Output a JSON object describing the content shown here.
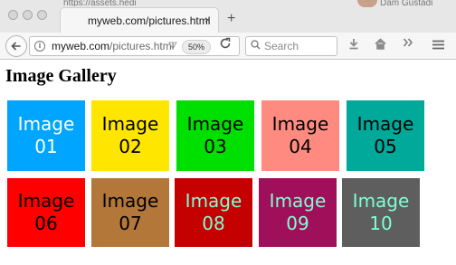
{
  "browser": {
    "ghost_tab_text": "https://assets.hedi",
    "ghost_right_text": "Dam Gustadi",
    "active_tab_title": "myweb.com/pictures.html",
    "tab_close_glyph": "×",
    "new_tab_glyph": "+",
    "url_domain": "myweb.com",
    "url_path": "/pictures.html",
    "zoom_level": "50%",
    "search_placeholder": "Search",
    "icons": [
      "back-arrow-icon",
      "info-icon",
      "reader-view-icon",
      "reload-icon",
      "search-icon",
      "download-icon",
      "home-icon",
      "overflow-chevrons-icon",
      "hamburger-menu-icon"
    ]
  },
  "page": {
    "title": "Image Gallery",
    "tiles": [
      {
        "line1": "Image",
        "line2": "01",
        "bg": "#00a5ff",
        "fg": "#ffffff"
      },
      {
        "line1": "Image",
        "line2": "02",
        "bg": "#ffe600",
        "fg": "#000000"
      },
      {
        "line1": "Image",
        "line2": "03",
        "bg": "#00e000",
        "fg": "#000000"
      },
      {
        "line1": "Image",
        "line2": "04",
        "bg": "#ff8b80",
        "fg": "#000000"
      },
      {
        "line1": "Image",
        "line2": "05",
        "bg": "#00a99a",
        "fg": "#000000"
      },
      {
        "line1": "Image",
        "line2": "06",
        "bg": "#ff0000",
        "fg": "#000000"
      },
      {
        "line1": "Image",
        "line2": "07",
        "bg": "#b3773a",
        "fg": "#000000"
      },
      {
        "line1": "Image",
        "line2": "08",
        "bg": "#c40000",
        "fg": "#7fffd4"
      },
      {
        "line1": "Image",
        "line2": "09",
        "bg": "#a0105a",
        "fg": "#7fffd4"
      },
      {
        "line1": "Image",
        "line2": "10",
        "bg": "#5e5e5e",
        "fg": "#7fffd4"
      }
    ]
  }
}
